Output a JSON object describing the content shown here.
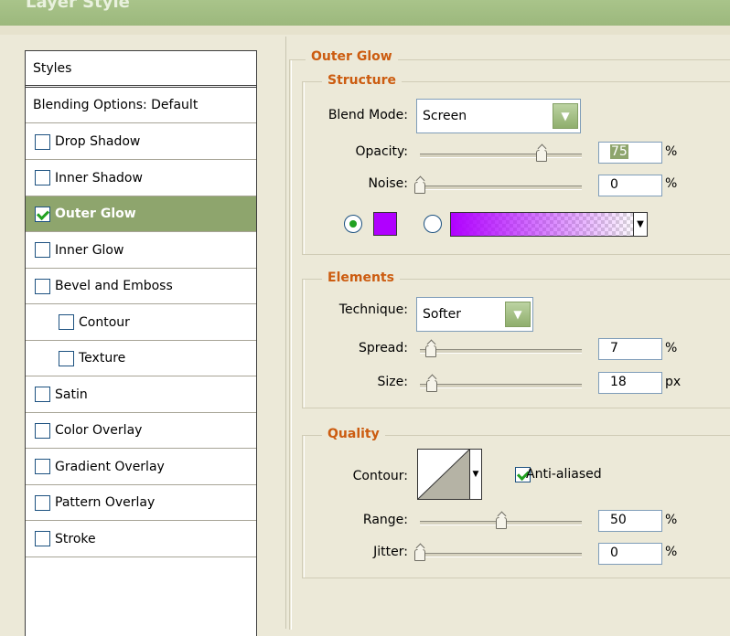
{
  "window": {
    "title": "Layer Style"
  },
  "styles_list": {
    "header": "Styles",
    "blending": "Blending Options: Default",
    "items": [
      {
        "label": "Drop Shadow",
        "checked": false,
        "sub": false
      },
      {
        "label": "Inner Shadow",
        "checked": false,
        "sub": false
      },
      {
        "label": "Outer Glow",
        "checked": true,
        "sub": false,
        "selected": true
      },
      {
        "label": "Inner Glow",
        "checked": false,
        "sub": false
      },
      {
        "label": "Bevel and Emboss",
        "checked": false,
        "sub": false
      },
      {
        "label": "Contour",
        "checked": false,
        "sub": true
      },
      {
        "label": "Texture",
        "checked": false,
        "sub": true
      },
      {
        "label": "Satin",
        "checked": false,
        "sub": false
      },
      {
        "label": "Color Overlay",
        "checked": false,
        "sub": false
      },
      {
        "label": "Gradient Overlay",
        "checked": false,
        "sub": false
      },
      {
        "label": "Pattern Overlay",
        "checked": false,
        "sub": false
      },
      {
        "label": "Stroke",
        "checked": false,
        "sub": false
      }
    ]
  },
  "outer_glow": {
    "title": "Outer Glow",
    "structure": {
      "title": "Structure",
      "blend_mode_label": "Blend Mode:",
      "blend_mode_value": "Screen",
      "opacity_label": "Opacity:",
      "opacity_value": "75",
      "opacity_unit": "%",
      "opacity_fraction": 0.75,
      "noise_label": "Noise:",
      "noise_value": "0",
      "noise_unit": "%",
      "noise_fraction": 0,
      "glow_color": "#b000ff"
    },
    "elements": {
      "title": "Elements",
      "technique_label": "Technique:",
      "technique_value": "Softer",
      "spread_label": "Spread:",
      "spread_value": "7",
      "spread_unit": "%",
      "spread_fraction": 0.07,
      "size_label": "Size:",
      "size_value": "18",
      "size_unit": "px",
      "size_fraction": 0.072
    },
    "quality": {
      "title": "Quality",
      "contour_label": "Contour:",
      "anti_aliased_label": "Anti-aliased",
      "anti_aliased": true,
      "range_label": "Range:",
      "range_value": "50",
      "range_unit": "%",
      "range_fraction": 0.5,
      "jitter_label": "Jitter:",
      "jitter_value": "0",
      "jitter_unit": "%",
      "jitter_fraction": 0
    }
  }
}
